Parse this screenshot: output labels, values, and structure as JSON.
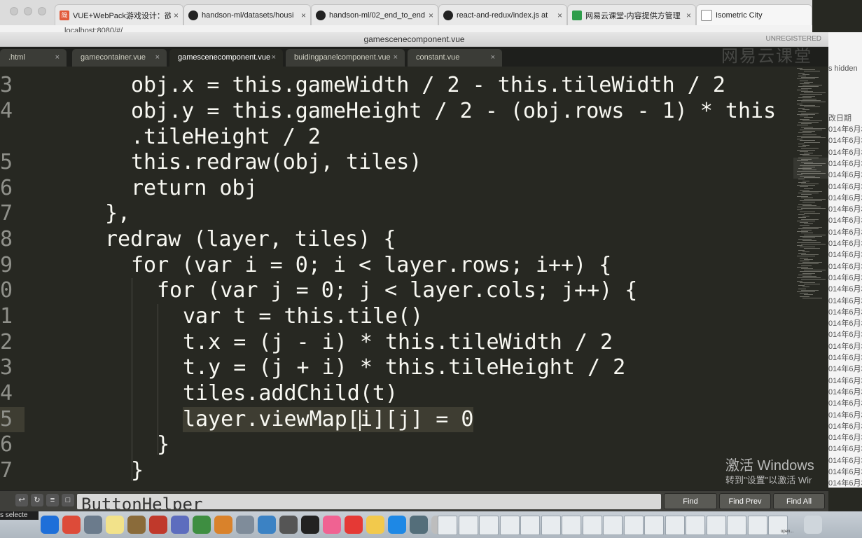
{
  "browser": {
    "tabs": [
      {
        "title": "VUE+WebPack游戏设计：欲",
        "icon": "jianshu-icon",
        "close": "×"
      },
      {
        "title": "handson-ml/datasets/housi",
        "icon": "github-icon",
        "close": "×"
      },
      {
        "title": "handson-ml/02_end_to_end",
        "icon": "github-icon",
        "close": "×"
      },
      {
        "title": "react-and-redux/index.js at",
        "icon": "github-icon",
        "close": "×"
      },
      {
        "title": "网易云课堂-内容提供方管理",
        "icon": "netease-icon",
        "close": "×"
      },
      {
        "title": "Isometric City",
        "icon": "page-icon",
        "close": ""
      }
    ],
    "url": "localhost:8080/#/"
  },
  "editor": {
    "window_title": "gamescenecomponent.vue",
    "unregistered": "UNREGISTERED",
    "tabs": [
      {
        "label": ".html",
        "close": "×"
      },
      {
        "label": "gamecontainer.vue",
        "close": "×"
      },
      {
        "label": "gamescenecomponent.vue",
        "close": "×"
      },
      {
        "label": "buidingpanelcomponent.vue",
        "close": "×"
      },
      {
        "label": "constant.vue",
        "close": "×"
      }
    ],
    "active_tab": 2,
    "gutter": [
      "3",
      "4",
      "",
      "5",
      "6",
      "7",
      "8",
      "9",
      "0",
      "1",
      "2",
      "3",
      "4",
      "5",
      "6",
      "7"
    ],
    "lines": [
      "obj.x = this.gameWidth / 2 - this.tileWidth / 2",
      "obj.y = this.gameHeight / 2 - (obj.rows - 1) * this",
      ".tileHeight / 2",
      "this.redraw(obj, tiles)",
      "return obj",
      "},",
      "redraw (layer, tiles) {",
      "for (var i = 0; i < layer.rows; i++) {",
      "for (var j = 0; j < layer.cols; j++) {",
      "var t = this.tile()",
      "t.x = (j - i) * this.tileWidth / 2",
      "t.y = (j + i) * this.tileHeight / 2",
      "tiles.addChild(t)",
      "",
      "}",
      "}"
    ],
    "current_line": {
      "before": "layer.viewMap[",
      "after": "i][j] = 0"
    }
  },
  "watermark": "网易云课堂",
  "findbar": {
    "input_value": "ButtonHelper",
    "find_label": "Find",
    "find_prev_label": "Find Prev",
    "find_all_label": "Find All",
    "status_text": "s selecte"
  },
  "right_panel": {
    "hidden_text": "s hidden",
    "date_header": "改日期",
    "date_rows": [
      "014年6月3",
      "014年6月3",
      "014年6月3",
      "014年6月3",
      "014年6月3",
      "014年6月3",
      "014年6月3",
      "014年6月3",
      "014年6月3",
      "014年6月3",
      "014年6月3",
      "014年6月3",
      "014年6月3",
      "014年6月3",
      "014年6月3",
      "014年6月3",
      "014年6月3",
      "014年6月3",
      "014年6月3",
      "014年6月3",
      "014年6月3",
      "014年6月3",
      "014年6月3",
      "014年6月3",
      "014年6月3",
      "014年6月3",
      "014年6月3",
      "014年6月3",
      "014年6月3",
      "014年6月3",
      "014年6月3",
      "014年6月3",
      "014年6月3"
    ]
  },
  "activation": {
    "title": "激活 Windows",
    "subtitle": "转到\"设置\"以激活 Wir"
  },
  "dock": {
    "label": "open...",
    "colors": [
      "#1e6fd9",
      "#dd4b39",
      "#6b7b8c",
      "#f2e28a",
      "#8a6b3a",
      "#c0392b",
      "#5d6dbe",
      "#3e8e41",
      "#d9822b",
      "#7f8c9a",
      "#3b82c4",
      "#555555",
      "#222222",
      "#f06292",
      "#e53935",
      "#f2c94c",
      "#1e88e5",
      "#546e7a",
      "#bdbdbd"
    ]
  }
}
